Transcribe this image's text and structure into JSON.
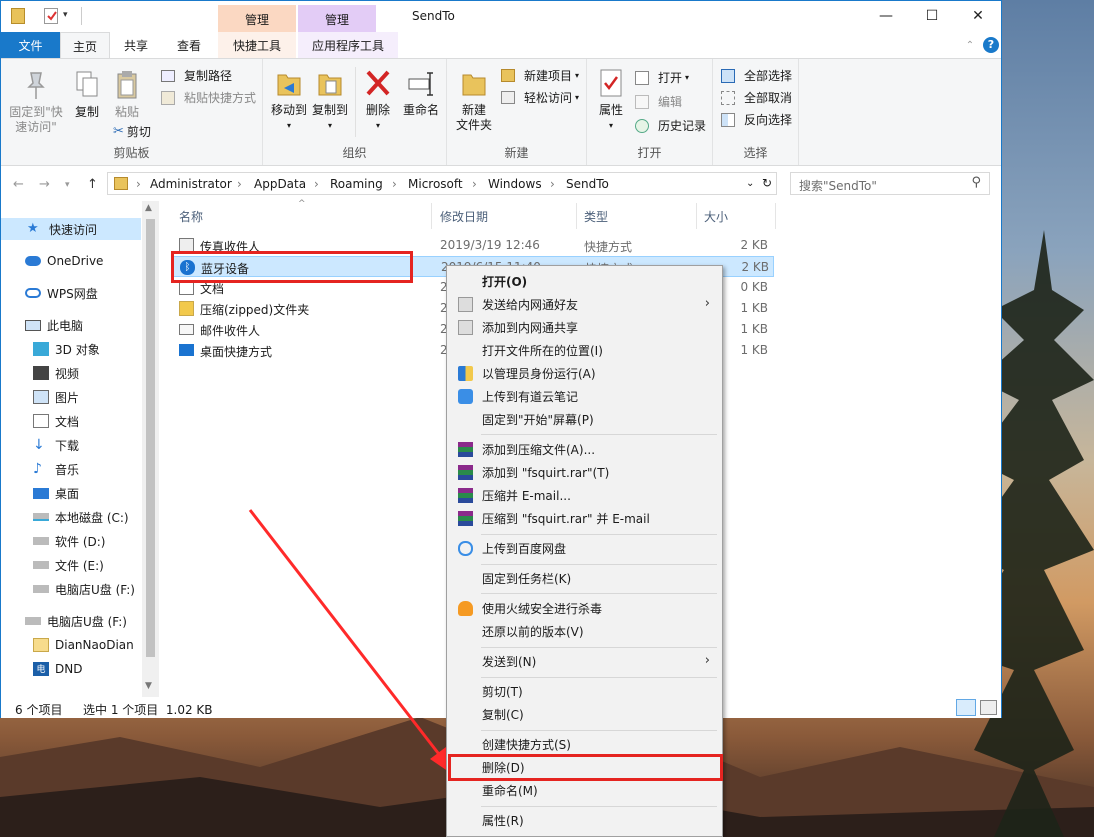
{
  "window": {
    "title": "SendTo",
    "context_tab_1": "管理",
    "context_tab_2": "管理",
    "minimize": "—",
    "maximize": "☐",
    "close": "✕",
    "accent": "#1979ca"
  },
  "tabs": {
    "file": "文件",
    "home": "主页",
    "share": "共享",
    "view": "查看",
    "shortcut_tools": "快捷工具",
    "app_tools": "应用程序工具"
  },
  "ribbon": {
    "clipboard": {
      "label": "剪贴板",
      "pin_line1": "固定到\"快",
      "pin_line2": "速访问\"",
      "copy": "复制",
      "paste": "粘贴",
      "copy_path": "复制路径",
      "paste_shortcut": "粘贴快捷方式",
      "cut": "剪切"
    },
    "organize": {
      "label": "组织",
      "move_to": "移动到",
      "copy_to": "复制到",
      "delete": "删除",
      "rename": "重命名"
    },
    "new": {
      "label": "新建",
      "new_folder_line1": "新建",
      "new_folder_line2": "文件夹",
      "new_item": "新建项目",
      "easy_access": "轻松访问"
    },
    "open": {
      "label": "打开",
      "properties": "属性",
      "open": "打开",
      "edit": "编辑",
      "history": "历史记录"
    },
    "select": {
      "label": "选择",
      "select_all": "全部选择",
      "select_none": "全部取消",
      "invert": "反向选择"
    }
  },
  "address": {
    "crumbs": [
      "Administrator",
      "AppData",
      "Roaming",
      "Microsoft",
      "Windows",
      "SendTo"
    ],
    "search_placeholder": "搜索\"SendTo\""
  },
  "nav": {
    "items": [
      "快速访问",
      "OneDrive",
      "WPS网盘",
      "此电脑",
      "3D 对象",
      "视频",
      "图片",
      "文档",
      "下载",
      "音乐",
      "桌面",
      "本地磁盘 (C:)",
      "软件 (D:)",
      "文件 (E:)",
      "电脑店U盘 (F:)",
      "电脑店U盘 (F:)",
      "DianNaoDian",
      "DND"
    ]
  },
  "columns": {
    "name": "名称",
    "date": "修改日期",
    "type": "类型",
    "size": "大小"
  },
  "files": [
    {
      "name": "传真收件人",
      "date": "2019/3/19 12:46",
      "type": "快捷方式",
      "size": "2 KB"
    },
    {
      "name": "蓝牙设备",
      "date": "2019/6/15 11:40",
      "type": "快捷方式",
      "size": "2 KB"
    },
    {
      "name": "文档",
      "date": "2",
      "type": "",
      "size": "0 KB"
    },
    {
      "name": "压缩(zipped)文件夹",
      "date": "2",
      "type": "",
      "size": "1 KB"
    },
    {
      "name": "邮件收件人",
      "date": "2",
      "type": "",
      "size": "1 KB"
    },
    {
      "name": "桌面快捷方式",
      "date": "2",
      "type": "",
      "size": "1 KB"
    }
  ],
  "status": {
    "count": "6 个项目",
    "selected": "选中 1 个项目  1.02 KB"
  },
  "context_menu": {
    "open": "打开(O)",
    "send_lan_friend": "发送给内网通好友",
    "add_lan_share": "添加到内网通共享",
    "open_location": "打开文件所在的位置(I)",
    "run_as_admin": "以管理员身份运行(A)",
    "youdao": "上传到有道云笔记",
    "pin_start": "固定到\"开始\"屏幕(P)",
    "add_archive": "添加到压缩文件(A)...",
    "add_rar": "添加到 \"fsquirt.rar\"(T)",
    "compress_email": "压缩并 E-mail...",
    "compress_rar_email": "压缩到 \"fsquirt.rar\" 并 E-mail",
    "baidu": "上传到百度网盘",
    "pin_taskbar": "固定到任务栏(K)",
    "huorong": "使用火绒安全进行杀毒",
    "restore": "还原以前的版本(V)",
    "send_to": "发送到(N)",
    "cut": "剪切(T)",
    "copy": "复制(C)",
    "create_shortcut": "创建快捷方式(S)",
    "delete": "删除(D)",
    "rename": "重命名(M)",
    "properties": "属性(R)"
  },
  "annotation_color": "#e52420"
}
